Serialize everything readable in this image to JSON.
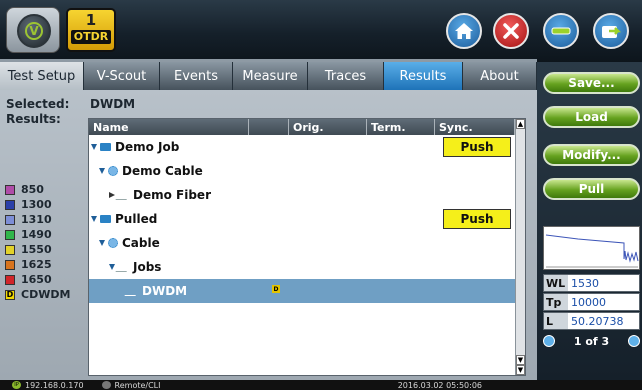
{
  "topbar": {
    "module_number": "1",
    "module_label": "OTDR"
  },
  "tabs": [
    {
      "label": "Test Setup"
    },
    {
      "label": "V-Scout"
    },
    {
      "label": "Events"
    },
    {
      "label": "Measure"
    },
    {
      "label": "Traces"
    },
    {
      "label": "Results"
    },
    {
      "label": "About"
    }
  ],
  "panel": {
    "selected_label": "Selected:",
    "selected_value": "DWDM",
    "results_label": "Results:"
  },
  "legend": [
    {
      "label": "850",
      "color": "#b04ca8"
    },
    {
      "label": "1300",
      "color": "#2b40a8"
    },
    {
      "label": "1310",
      "color": "#7d8ed6"
    },
    {
      "label": "1490",
      "color": "#2fb54a"
    },
    {
      "label": "1550",
      "color": "#e2d22a"
    },
    {
      "label": "1625",
      "color": "#d7741e"
    },
    {
      "label": "1650",
      "color": "#d1252a"
    },
    {
      "label": "CDWDM",
      "color": "#f1d800",
      "badge": "D"
    }
  ],
  "tree": {
    "columns": [
      "Name",
      "Orig.",
      "Term.",
      "Sync."
    ],
    "rows": [
      {
        "label": "Demo Job",
        "push": "Push"
      },
      {
        "label": "Demo Cable"
      },
      {
        "label": "Demo Fiber"
      },
      {
        "label": "Pulled",
        "push": "Push"
      },
      {
        "label": "Cable"
      },
      {
        "label": "Jobs"
      },
      {
        "label": "DWDM",
        "badge": "D"
      }
    ]
  },
  "side": {
    "save": "Save...",
    "load": "Load",
    "modify": "Modify...",
    "pull": "Pull"
  },
  "info": {
    "wl_key": "WL",
    "wl_val": "1530",
    "tp_key": "Tp",
    "tp_val": "10000",
    "l_key": "L",
    "l_val": "50.20738",
    "page": "1 of 3"
  },
  "status": {
    "ip": "192.168.0.170",
    "ip_badge": "IP",
    "remote": "Remote/CLI",
    "datetime": "2016.03.02  05:50:06"
  }
}
